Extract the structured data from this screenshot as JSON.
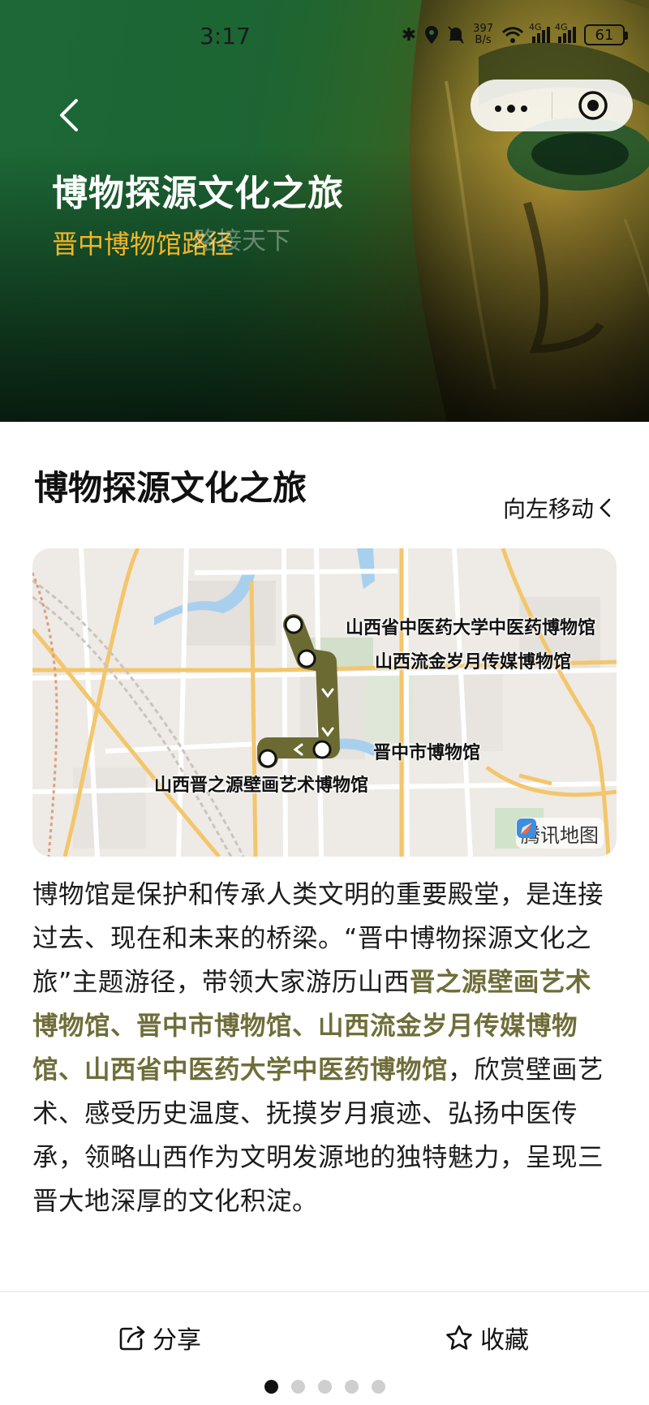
{
  "status_bar": {
    "time": "3:17",
    "net_speed_value": "397",
    "net_speed_unit": "B/s",
    "battery": "61",
    "signal_label_1": "4G",
    "signal_label_2": "4G"
  },
  "hero": {
    "title": "博物探源文化之旅",
    "subtitle": "晋中博物馆路径",
    "background_text": "路接天下"
  },
  "capsule": {
    "more_icon": "more-dots-icon",
    "close_icon": "target-icon"
  },
  "content": {
    "section_title": "博物探源文化之旅",
    "move_left_label": "向左移动"
  },
  "map": {
    "provider": "腾讯地图",
    "route_color": "#6b6a32",
    "stops": [
      {
        "name": "山西省中医药大学中医药博物馆"
      },
      {
        "name": "山西流金岁月传媒博物馆"
      },
      {
        "name": "晋中市博物馆"
      },
      {
        "name": "山西晋之源壁画艺术博物馆"
      }
    ]
  },
  "description": {
    "part1": "博物馆是保护和传承人类文明的重要殿堂，是连接过去、现在和未来的桥梁。“晋中博物探源文化之旅”主题游径，带领大家游历山西",
    "highlight": "晋之源壁画艺术博物馆、晋中市博物馆、山西流金岁月传媒博物馆、山西省中医药大学中医药博物馆",
    "part2": "，欣赏壁画艺术、感受历史温度、抚摸岁月痕迹、弘扬中医传承，领略山西作为文明发源地的独特魅力，呈现三晋大地深厚的文化积淀。",
    "highlight_color": "#6f6e3a"
  },
  "bottom_bar": {
    "share_label": "分享",
    "favorite_label": "收藏",
    "page_count": 5,
    "active_page": 1
  }
}
